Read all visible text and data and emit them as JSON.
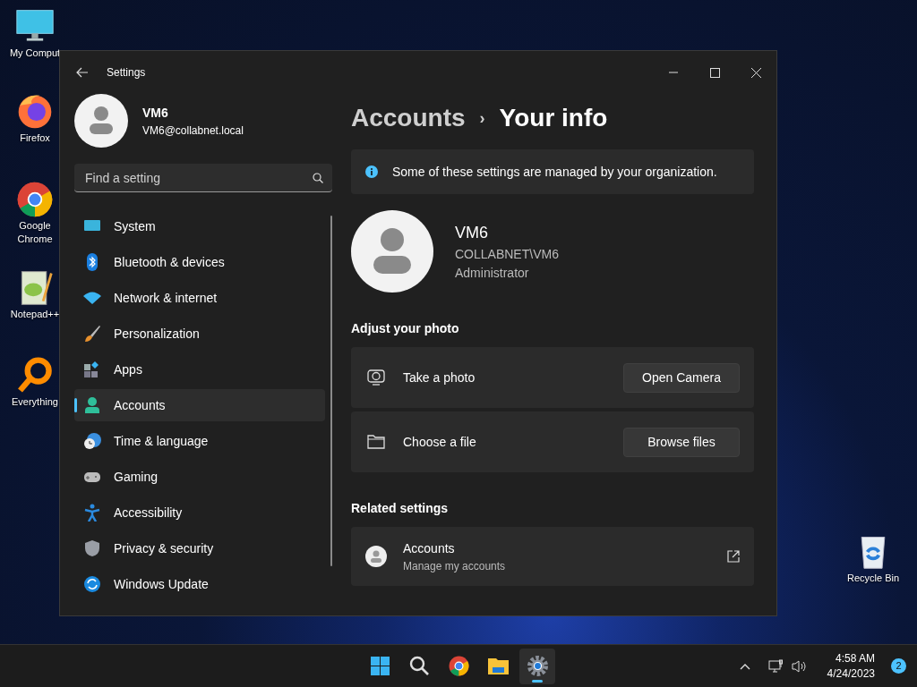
{
  "desktop_icons": [
    {
      "label": "My Comput",
      "kind": "monitor"
    },
    {
      "label": "Firefox",
      "kind": "firefox"
    },
    {
      "label": "Google Chrome",
      "kind": "chrome"
    },
    {
      "label": "Notepad++",
      "kind": "notepad"
    },
    {
      "label": "Everything",
      "kind": "everything"
    },
    {
      "label": "Recycle Bin",
      "kind": "recycle"
    }
  ],
  "window": {
    "title": "Settings"
  },
  "user": {
    "name": "VM6",
    "email": "VM6@collabnet.local"
  },
  "search": {
    "placeholder": "Find a setting"
  },
  "nav_items": [
    {
      "label": "System",
      "selected": false
    },
    {
      "label": "Bluetooth & devices",
      "selected": false
    },
    {
      "label": "Network & internet",
      "selected": false
    },
    {
      "label": "Personalization",
      "selected": false
    },
    {
      "label": "Apps",
      "selected": false
    },
    {
      "label": "Accounts",
      "selected": true
    },
    {
      "label": "Time & language",
      "selected": false
    },
    {
      "label": "Gaming",
      "selected": false
    },
    {
      "label": "Accessibility",
      "selected": false
    },
    {
      "label": "Privacy & security",
      "selected": false
    },
    {
      "label": "Windows Update",
      "selected": false
    }
  ],
  "breadcrumb": {
    "parent": "Accounts",
    "separator": "›",
    "current": "Your info"
  },
  "notice": "Some of these settings are managed by your organization.",
  "profile": {
    "name": "VM6",
    "account": "COLLABNET\\VM6",
    "role": "Administrator"
  },
  "adjust_photo": {
    "heading": "Adjust your photo",
    "rows": [
      {
        "label": "Take a photo",
        "button": "Open Camera"
      },
      {
        "label": "Choose a file",
        "button": "Browse files"
      }
    ]
  },
  "related_settings": {
    "heading": "Related settings",
    "items": [
      {
        "title": "Accounts",
        "subtitle": "Manage my accounts"
      }
    ]
  },
  "taskbar": {
    "apps": [
      {
        "kind": "start",
        "active": false
      },
      {
        "kind": "search",
        "active": false
      },
      {
        "kind": "chrome",
        "active": false
      },
      {
        "kind": "explorer",
        "active": false
      },
      {
        "kind": "settings",
        "active": true
      }
    ],
    "time": "4:58 AM",
    "date": "4/24/2023",
    "notifications": "2"
  }
}
